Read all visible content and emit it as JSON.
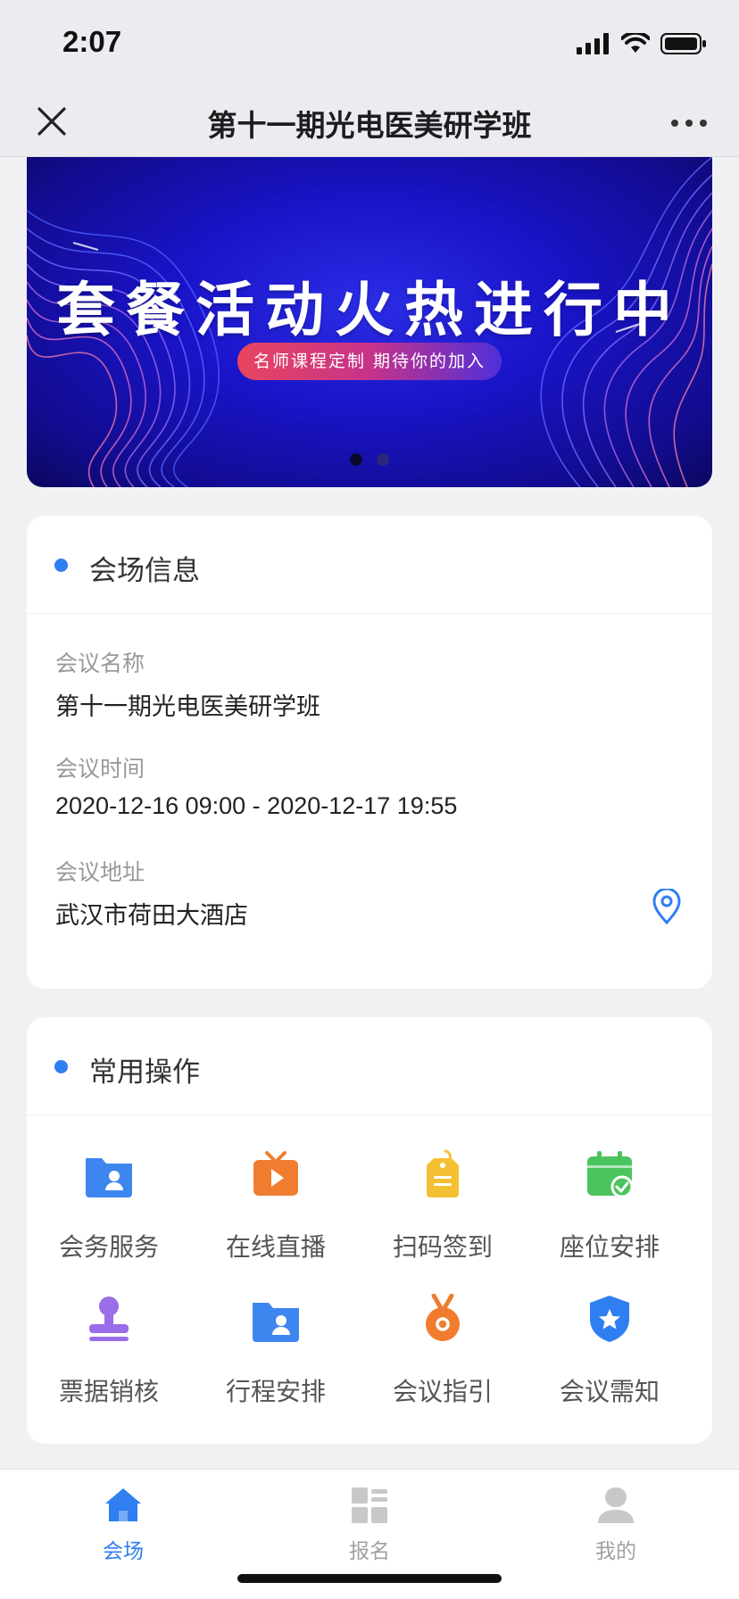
{
  "status_bar": {
    "time": "2:07"
  },
  "nav": {
    "title": "第十一期光电医美研学班"
  },
  "banner": {
    "title": "套餐活动火热进行中",
    "subtitle": "名师课程定制 期待你的加入",
    "slides": 2,
    "active_slide": 1
  },
  "venue_card": {
    "title": "会场信息",
    "fields": [
      {
        "label": "会议名称",
        "value": "第十一期光电医美研学班"
      },
      {
        "label": "会议时间",
        "value": "2020-12-16 09:00 - 2020-12-17 19:55"
      },
      {
        "label": "会议地址",
        "value": "武汉市荷田大酒店"
      }
    ],
    "location_icon": "map-pin-icon"
  },
  "ops_card": {
    "title": "常用操作",
    "items": [
      {
        "label": "会务服务",
        "icon": "folder-user-icon",
        "color": "#3d86f0"
      },
      {
        "label": "在线直播",
        "icon": "tv-play-icon",
        "color": "#f07d2f"
      },
      {
        "label": "扫码签到",
        "icon": "tag-icon",
        "color": "#f4c033"
      },
      {
        "label": "座位安排",
        "icon": "calendar-check-icon",
        "color": "#4bc45e"
      },
      {
        "label": "票据销核",
        "icon": "stamp-icon",
        "color": "#9a6ee8"
      },
      {
        "label": "行程安排",
        "icon": "folder-user-icon",
        "color": "#3d86f0"
      },
      {
        "label": "会议指引",
        "icon": "medal-icon",
        "color": "#f07d2f"
      },
      {
        "label": "会议需知",
        "icon": "shield-star-icon",
        "color": "#2f7ef2"
      }
    ]
  },
  "tab_bar": {
    "tabs": [
      {
        "label": "会场",
        "icon": "home-icon",
        "active": true
      },
      {
        "label": "报名",
        "icon": "grid-list-icon",
        "active": false
      },
      {
        "label": "我的",
        "icon": "user-icon",
        "active": false
      }
    ],
    "accent": "#2f7ef2"
  }
}
